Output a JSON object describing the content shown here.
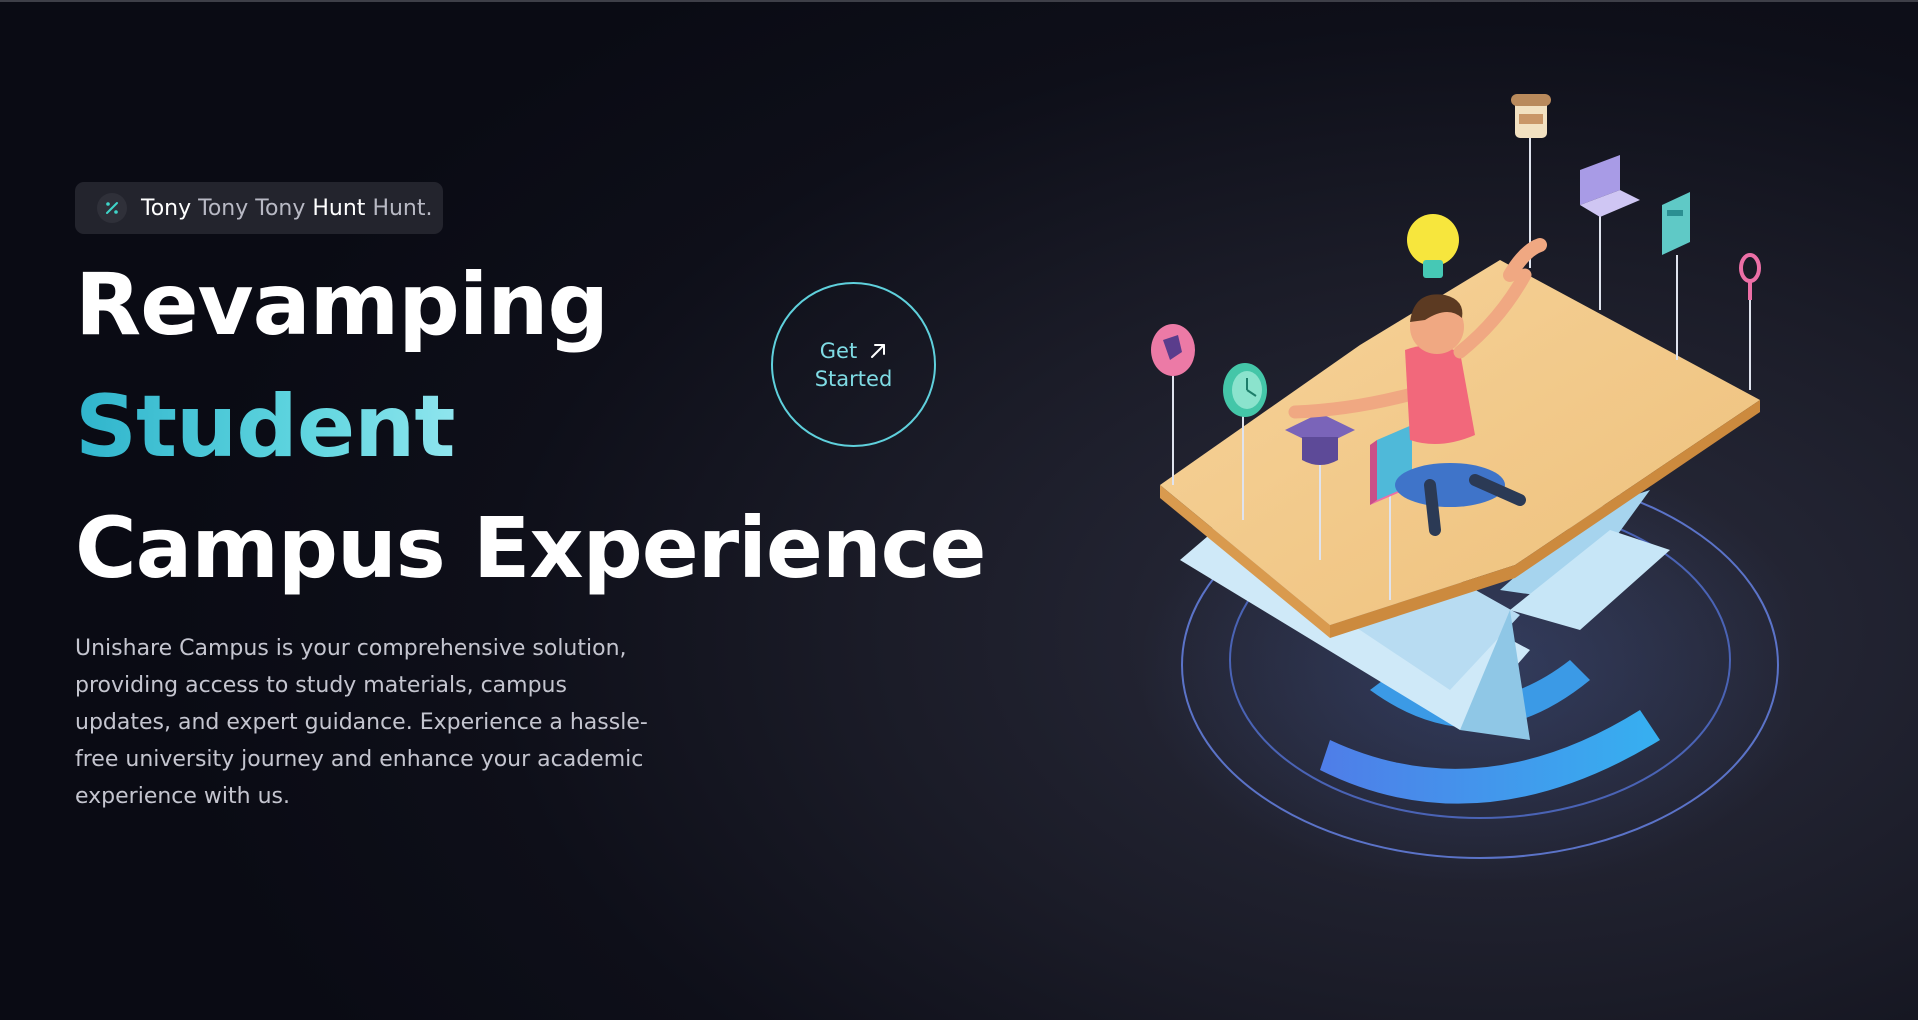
{
  "badge": {
    "icon": "percent-icon",
    "parts": [
      "Tony",
      "Tony Tony",
      "Hunt",
      "Hunt."
    ]
  },
  "hero": {
    "line1": "Revamping",
    "line2": "Student",
    "line3": "Campus Experience",
    "description": "Unishare Campus is your comprehensive solution, providing access to study materials, campus updates, and expert guidance. Experience a hassle-free university journey and enhance your academic experience with us."
  },
  "cta": {
    "line1": "Get",
    "line2": "Started",
    "icon": "arrow-up-right-icon"
  },
  "illustration": {
    "name": "student-on-book-illustration",
    "icons": [
      "coffee-cup-icon",
      "lightbulb-icon",
      "laptop-icon",
      "calculator-icon",
      "magnifier-icon",
      "globe-icon",
      "clock-icon",
      "graduation-cap-icon",
      "books-icon"
    ]
  },
  "colors": {
    "accent": "#5fd0dc",
    "background": "#0e0f19",
    "badge_bg": "#23242d"
  }
}
